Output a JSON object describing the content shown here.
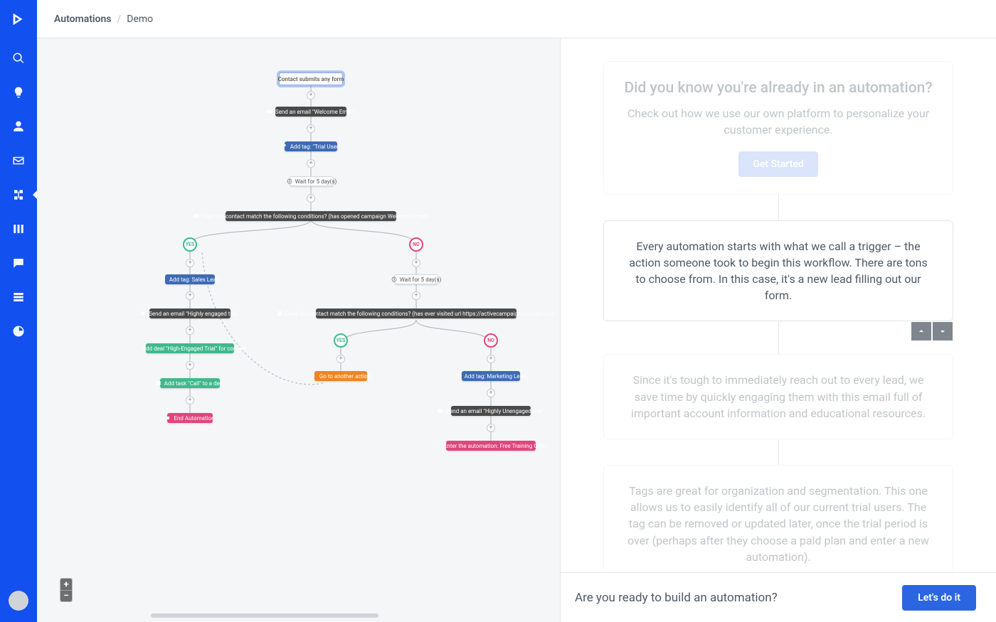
{
  "breadcrumb": {
    "root": "Automations",
    "current": "Demo"
  },
  "sidebar": {
    "logo": "active-campaign",
    "items": [
      {
        "name": "search"
      },
      {
        "name": "lightbulb"
      },
      {
        "name": "contacts"
      },
      {
        "name": "campaigns"
      },
      {
        "name": "automations",
        "active": true
      },
      {
        "name": "deals"
      },
      {
        "name": "conversations"
      },
      {
        "name": "calendar"
      },
      {
        "name": "reports"
      }
    ],
    "bottom": [
      {
        "name": "apps"
      },
      {
        "name": "settings"
      }
    ]
  },
  "zoom": {
    "in": "+",
    "out": "−"
  },
  "flow": {
    "trigger": {
      "label": "Contact submits any form"
    },
    "nodes": {
      "n1": {
        "label": "Send an email \"Welcome Email\""
      },
      "n2": {
        "label": "Add tag: \"Trial User\""
      },
      "n3": {
        "label": "Wait for 5 day(s)"
      },
      "n4": {
        "label": "Does the contact match the following conditions? (has opened campaign Welcome Email)"
      },
      "n5": {
        "label": "Add tag: Sales Lead"
      },
      "n6": {
        "label": "Send an email \"Highly engaged trial\""
      },
      "n7": {
        "label": "Add deal \"High-Engaged Trial\" for contact"
      },
      "n8": {
        "label": "Add task \"Call\" to a deal"
      },
      "n9": {
        "label": "End Automation"
      },
      "n10": {
        "label": "Wait for 5 day(s)"
      },
      "n11": {
        "label": "Does the contact match the following conditions? (has ever visited url https://activecampaign.com/pricing)"
      },
      "n12": {
        "label": "Go to another action"
      },
      "n13": {
        "label": "Add tag: Marketing Lead"
      },
      "n14": {
        "label": "Send an email \"Highly Unengaged trial\""
      },
      "n15": {
        "label": "Enter the automation: Free Training Offer"
      }
    },
    "branches": {
      "yes": "YES",
      "no": "NO"
    }
  },
  "sidekick": {
    "intro": {
      "title": "Did you know you're already in an automation?",
      "body": "Check out how we use our own platform to personalize your customer experience.",
      "cta": "Get Started"
    },
    "steps": [
      {
        "body": "Every automation starts with what we call a trigger – the action someone took to begin this workflow. There are tons to choose from. In this case, it's a new lead filling out our form."
      },
      {
        "body": "Since it's tough to immediately reach out to every lead, we save time by quickly engaging them with this email full of important account information and educational resources."
      },
      {
        "body": "Tags are great for organization and segmentation. This one allows us to easily identify all of our current trial users. The tag can be removed or updated later, once the trial period is over (perhaps after they choose a paid plan and enter a new automation)."
      }
    ]
  },
  "cta": {
    "prompt": "Are you ready to build an automation?",
    "button": "Let's do it"
  }
}
